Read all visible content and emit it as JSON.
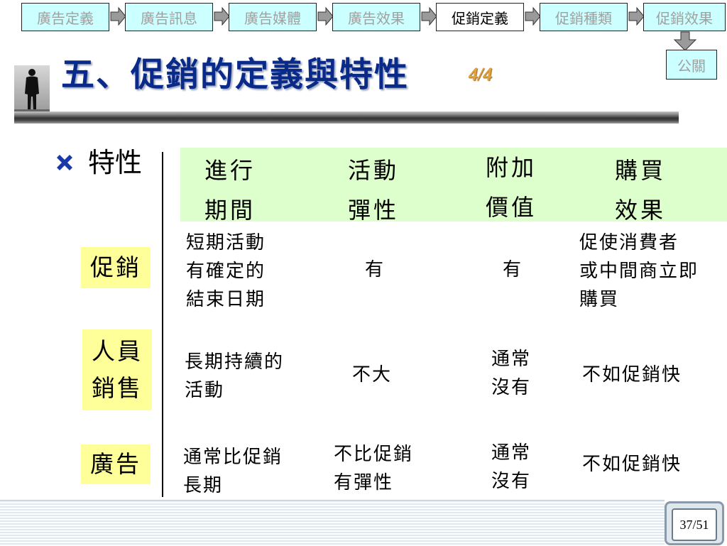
{
  "nav": {
    "items": [
      "廣告定義",
      "廣告訊息",
      "廣告媒體",
      "廣告效果",
      "促銷定義",
      "促銷種類",
      "促銷效果"
    ],
    "active_index": 4,
    "pr_label": "公關"
  },
  "title": {
    "text": "五、促銷的定義與特性",
    "page_mark": "4/4"
  },
  "section": {
    "label": "特性"
  },
  "table": {
    "headers": [
      [
        "進行",
        "期間"
      ],
      [
        "活動",
        "彈性"
      ],
      [
        "附加",
        "價值"
      ],
      [
        "購買",
        "效果"
      ]
    ],
    "rows": [
      {
        "label": [
          "促銷"
        ],
        "cells": [
          [
            "短期活動",
            "有確定的",
            "結束日期"
          ],
          [
            "有"
          ],
          [
            "有"
          ],
          [
            "促使消費者",
            "或中間商立即",
            "購買"
          ]
        ]
      },
      {
        "label": [
          "人員",
          "銷售"
        ],
        "cells": [
          [
            "長期持續的",
            "活動"
          ],
          [
            "不大"
          ],
          [
            "通常",
            "沒有"
          ],
          [
            "不如促銷快"
          ]
        ]
      },
      {
        "label": [
          "廣告"
        ],
        "cells": [
          [
            "通常比促銷",
            "長期"
          ],
          [
            "不比促銷",
            "有彈性"
          ],
          [
            "通常",
            "沒有"
          ],
          [
            "不如促銷快"
          ]
        ]
      }
    ]
  },
  "page_counter": "37/51",
  "colors": {
    "nav_bg": "#ccffff",
    "title": "#0a2a8a",
    "header_bg": "#ddffcc",
    "label_bg": "#ffff99",
    "page_mark": "#e8a038"
  }
}
